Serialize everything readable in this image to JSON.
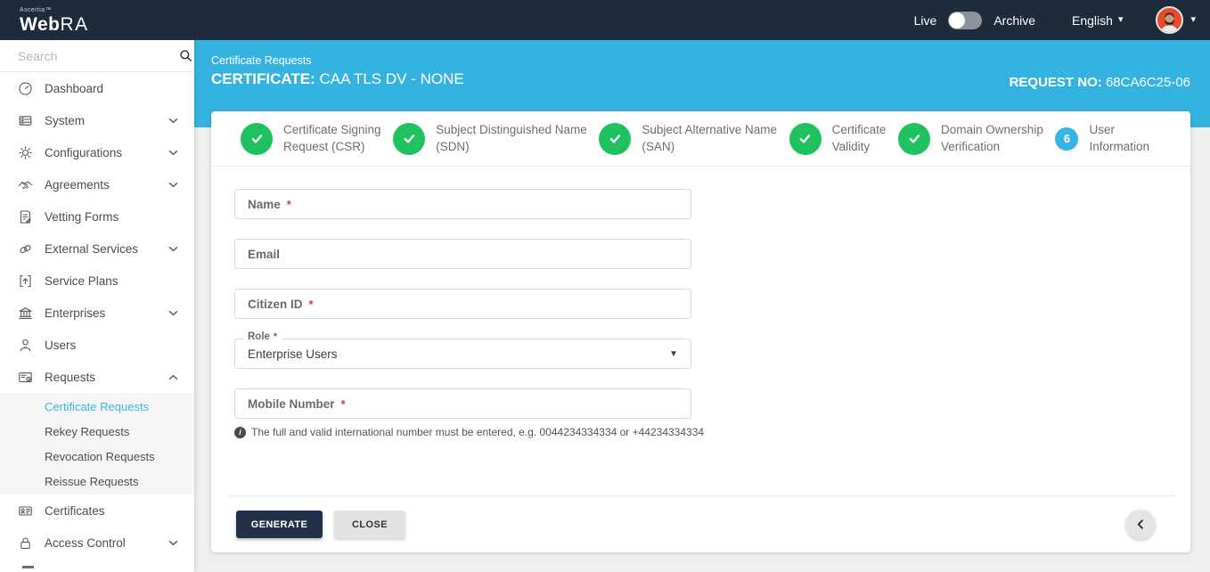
{
  "navbar": {
    "brand_small": "Ascertia™",
    "brand_bold": "Web",
    "brand_light": "RA",
    "live_label": "Live",
    "archive_label": "Archive",
    "language_label": "English"
  },
  "icons": {
    "caret_down": "▾",
    "select_caret": "▼"
  },
  "sidebar": {
    "search_placeholder": "Search",
    "items": [
      {
        "label": "Dashboard"
      },
      {
        "label": "System"
      },
      {
        "label": "Configurations"
      },
      {
        "label": "Agreements"
      },
      {
        "label": "Vetting Forms"
      },
      {
        "label": "External Services"
      },
      {
        "label": "Service Plans"
      },
      {
        "label": "Enterprises"
      },
      {
        "label": "Users"
      },
      {
        "label": "Requests"
      },
      {
        "label": "Certificates"
      },
      {
        "label": "Access Control"
      }
    ],
    "requests_submenu": [
      {
        "label": "Certificate Requests",
        "active": true
      },
      {
        "label": "Rekey Requests",
        "active": false
      },
      {
        "label": "Revocation Requests",
        "active": false
      },
      {
        "label": "Reissue Requests",
        "active": false
      }
    ]
  },
  "header": {
    "breadcrumb": "Certificate Requests",
    "title_label": "CERTIFICATE:",
    "title_value": "CAA TLS DV - NONE",
    "request_no_label": "REQUEST NO:",
    "request_no_value": "68CA6C25-06"
  },
  "stepper": {
    "steps": [
      {
        "line1": "Certificate Signing",
        "line2": "Request (CSR)",
        "state": "done"
      },
      {
        "line1": "Subject Distinguished Name",
        "line2": "(SDN)",
        "state": "done"
      },
      {
        "line1": "Subject Alternative Name",
        "line2": "(SAN)",
        "state": "done"
      },
      {
        "line1": "Certificate",
        "line2": "Validity",
        "state": "done"
      },
      {
        "line1": "Domain Ownership",
        "line2": "Verification",
        "state": "done"
      },
      {
        "num": "6",
        "line1": "User",
        "line2": "Information",
        "state": "current"
      }
    ]
  },
  "form": {
    "required_mark": "*",
    "name_label": "Name",
    "email_label": "Email",
    "citizen_label": "Citizen ID",
    "role_label": "Role",
    "role_value": "Enterprise Users",
    "mobile_label": "Mobile Number",
    "hint_icon_glyph": "i",
    "mobile_hint": "The full and valid international number must be entered, e.g. 0044234334334 or +44234334334"
  },
  "actions": {
    "generate_label": "GENERATE",
    "close_label": "CLOSE"
  },
  "colors": {
    "navbar_bg": "#1d2b3b",
    "accent_cyan": "#35b3e0",
    "success_green": "#1ec25e",
    "active_link": "#38b5e6",
    "dark_button": "#233049"
  }
}
